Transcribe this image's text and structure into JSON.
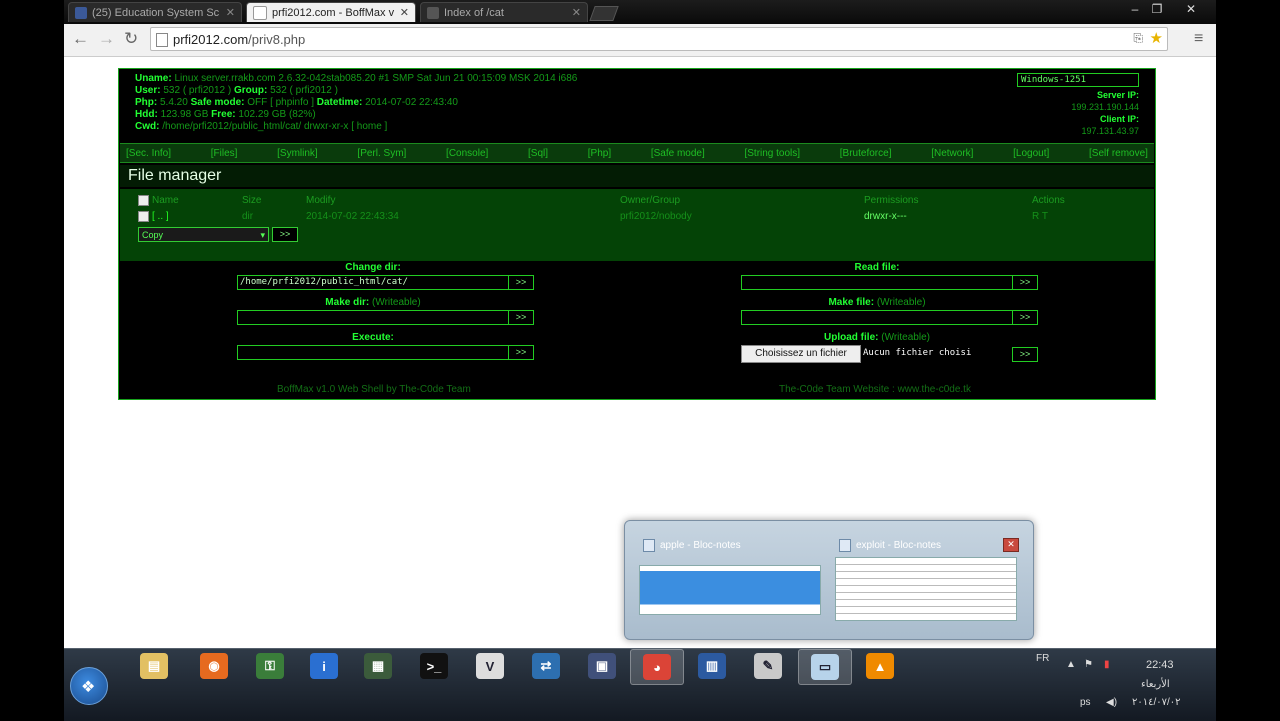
{
  "tabs": [
    {
      "title": "(25) Education System Sc",
      "active": false,
      "favicon_color": "#3b5998"
    },
    {
      "title": "prfi2012.com - BoffMax v",
      "active": true,
      "favicon_color": "#cccccc"
    },
    {
      "title": "Index of /cat",
      "active": false,
      "favicon_color": "#999999"
    }
  ],
  "window_controls": {
    "minimize": "–",
    "restore": "❐",
    "close": "✕"
  },
  "url": {
    "host": "prfi2012.com",
    "path": "/priv8.php"
  },
  "shell": {
    "info": {
      "uname_label": "Uname:",
      "uname": "Linux server.rrakb.com 2.6.32-042stab085.20 #1 SMP Sat Jun 21 00:15:09 MSK 2014 i686",
      "user_label": "User:",
      "user": "532 ( prfi2012 )",
      "group_label": "Group:",
      "group": "532 ( prfi2012 )",
      "php_label": "Php:",
      "php": "5.4.20",
      "safe_label": "Safe mode:",
      "safe": "OFF",
      "phpinfo": "[ phpinfo ]",
      "datetime_label": "Datetime:",
      "datetime": "2014-07-02 22:43:40",
      "hdd_label": "Hdd:",
      "hdd": "123.98 GB",
      "free_label": "Free:",
      "free": "102.29 GB (82%)",
      "cwd_label": "Cwd:",
      "cwd": "/home/prfi2012/public_html/cat/",
      "cwd_perm": "drwxr-xr-x",
      "home": "[ home ]"
    },
    "charset": "Windows-1251",
    "server_ip_label": "Server IP:",
    "server_ip": "199.231.190.144",
    "client_ip_label": "Client IP:",
    "client_ip": "197.131.43.97",
    "menu": [
      "[Sec. Info]",
      "[Files]",
      "[Symlink]",
      "[Perl. Sym]",
      "[Console]",
      "[Sql]",
      "[Php]",
      "[Safe mode]",
      "[String tools]",
      "[Bruteforce]",
      "[Network]",
      "[Logout]",
      "[Self remove]"
    ],
    "fm_title": "File manager",
    "columns": {
      "name": "Name",
      "size": "Size",
      "modify": "Modify",
      "owner": "Owner/Group",
      "perm": "Permissions",
      "actions": "Actions"
    },
    "row": {
      "name": "[ .. ]",
      "size": "dir",
      "modify": "2014-07-02 22:43:34",
      "owner": "prfi2012/nobody",
      "perm": "drwxr-x---",
      "actions": "R T"
    },
    "copy_select": "Copy",
    "go": ">>",
    "forms": {
      "change_dir": "Change dir:",
      "change_dir_value": "/home/prfi2012/public_html/cat/",
      "make_dir": "Make dir:",
      "writeable": "(Writeable)",
      "execute": "Execute:",
      "read_file": "Read file:",
      "make_file": "Make file:",
      "upload_file": "Upload file:",
      "choose_file": "Choisissez un fichier",
      "no_file": "Aucun fichier choisi"
    },
    "footer_left": "BoffMax v1.0 Web Shell by The-C0de Team",
    "footer_right": "The-C0de Team Website : www.the-c0de.tk"
  },
  "preview": {
    "item1": "apple - Bloc-notes",
    "item2": "exploit - Bloc-notes",
    "close": "✕"
  },
  "taskbar": {
    "start_glyph": "❖",
    "apps": [
      {
        "name": "explorer",
        "color": "#e2c063",
        "glyph": "▤"
      },
      {
        "name": "firefox",
        "color": "#e66a1f",
        "glyph": "◉"
      },
      {
        "name": "network-tool",
        "color": "#3a7d3a",
        "glyph": "⚿"
      },
      {
        "name": "info",
        "color": "#2a6fd1",
        "glyph": "i"
      },
      {
        "name": "monitor",
        "color": "#3b5b3b",
        "glyph": "▦"
      },
      {
        "name": "cmd",
        "color": "#111111",
        "glyph": ">_"
      },
      {
        "name": "vmware",
        "color": "#dddddd",
        "glyph": "V"
      },
      {
        "name": "network-share",
        "color": "#2d6fb0",
        "glyph": "⇄"
      },
      {
        "name": "utility",
        "color": "#40507a",
        "glyph": "▣"
      },
      {
        "name": "chrome",
        "color": "#db4437",
        "glyph": "◕"
      },
      {
        "name": "remote-desktop",
        "color": "#2c5aa0",
        "glyph": "▥"
      },
      {
        "name": "paint",
        "color": "#c9c9c9",
        "glyph": "✎"
      },
      {
        "name": "notepad",
        "color": "#b7d3ea",
        "glyph": "▭"
      },
      {
        "name": "vlc",
        "color": "#f08a00",
        "glyph": "▲"
      }
    ],
    "tray": {
      "lang": "FR",
      "time": "22:43",
      "day": "الأربعاء",
      "date": "٢٠١٤/٠٧/٠٢",
      "tray_text": "ps"
    }
  }
}
